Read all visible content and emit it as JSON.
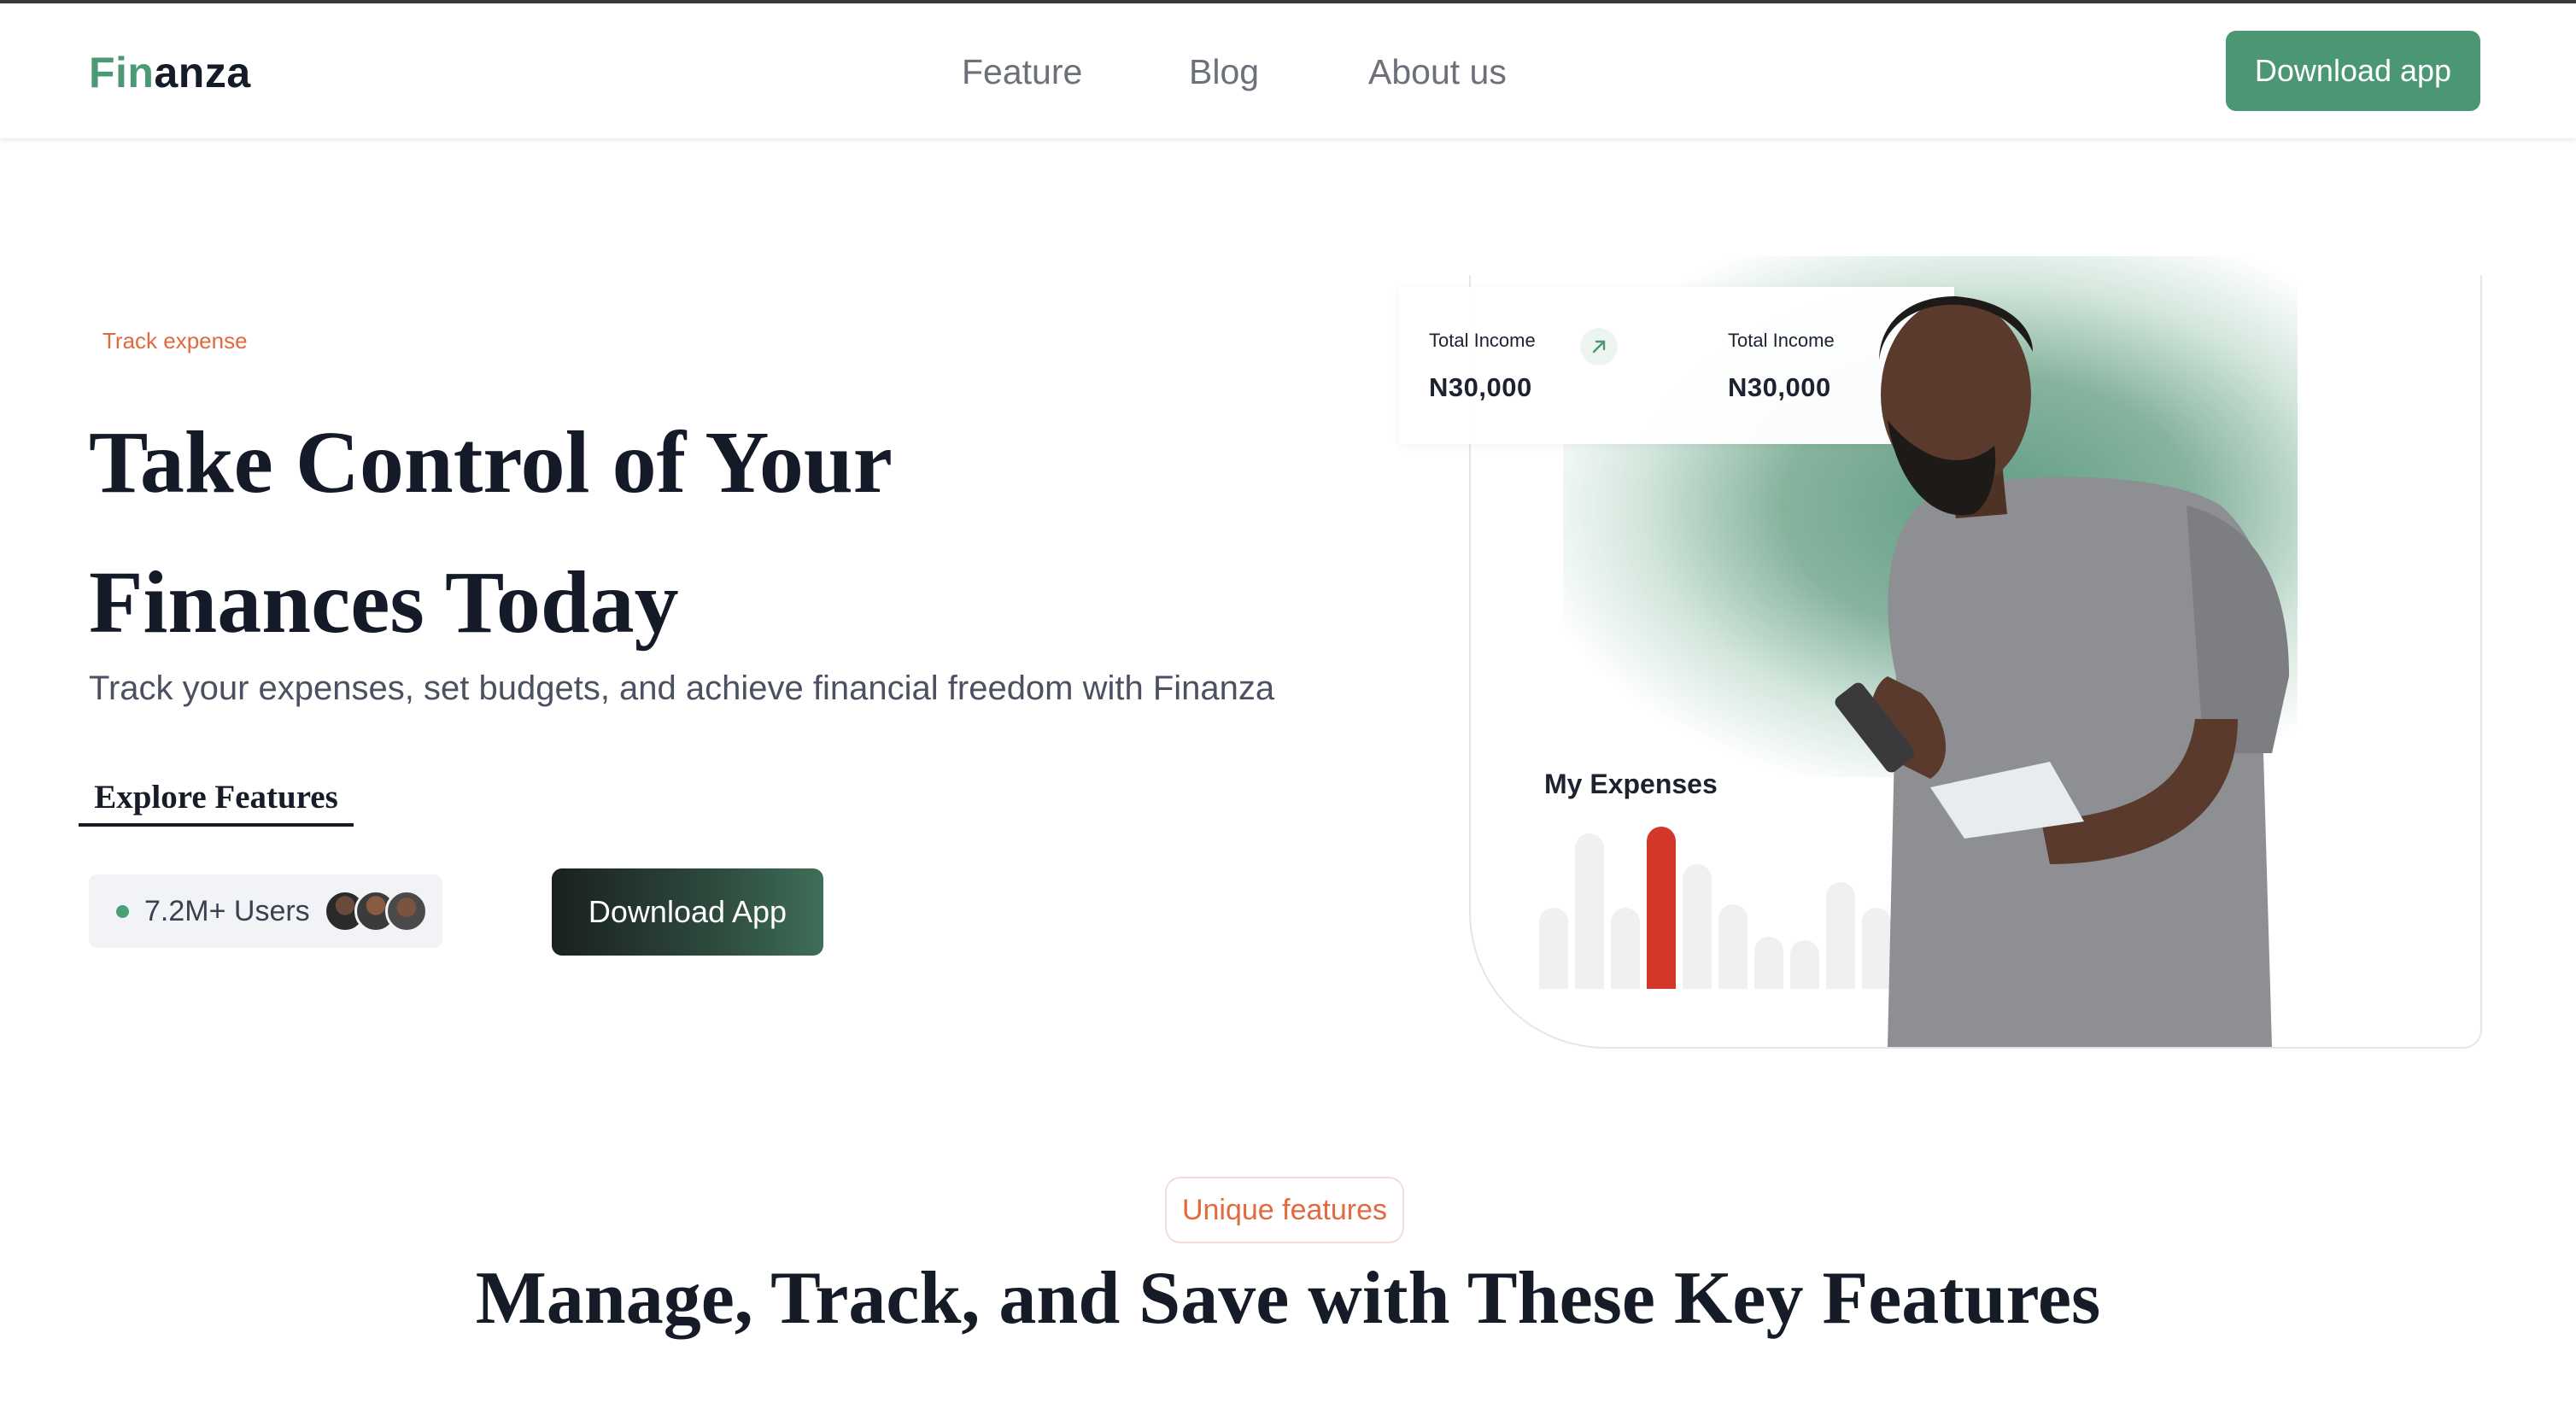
{
  "brand": {
    "part1": "Fin",
    "part2": "anza",
    "accent": "#4c9a75"
  },
  "nav": {
    "items": [
      "Feature",
      "Blog",
      "About us"
    ]
  },
  "header": {
    "cta_label": "Download app"
  },
  "hero": {
    "tag": "Track expense",
    "title_line1": "Take Control of Your",
    "title_line2": "Finances Today",
    "subtitle": "Track your expenses, set budgets, and achieve financial freedom with Finanza",
    "explore_label": "Explore Features",
    "users_label": "7.2M+ Users",
    "download_label": "Download App"
  },
  "dashboard": {
    "income_cards": [
      {
        "label": "Total Income",
        "value": "N30,000"
      },
      {
        "label": "Total Income",
        "value": "N30,000"
      }
    ],
    "trend_icon": "arrow-up-right-icon",
    "expenses_title": "My Expenses",
    "expense_bars": [
      0.5,
      0.96,
      0.5,
      1.0,
      0.77,
      0.52,
      0.32,
      0.3,
      0.66,
      0.5
    ],
    "highlight_index": 3
  },
  "features": {
    "badge": "Unique features",
    "title": "Manage, Track, and Save with These Key Features"
  },
  "colors": {
    "green": "#4b9774",
    "orange": "#e2683e",
    "red": "#d3372a",
    "dark": "#141a28"
  }
}
